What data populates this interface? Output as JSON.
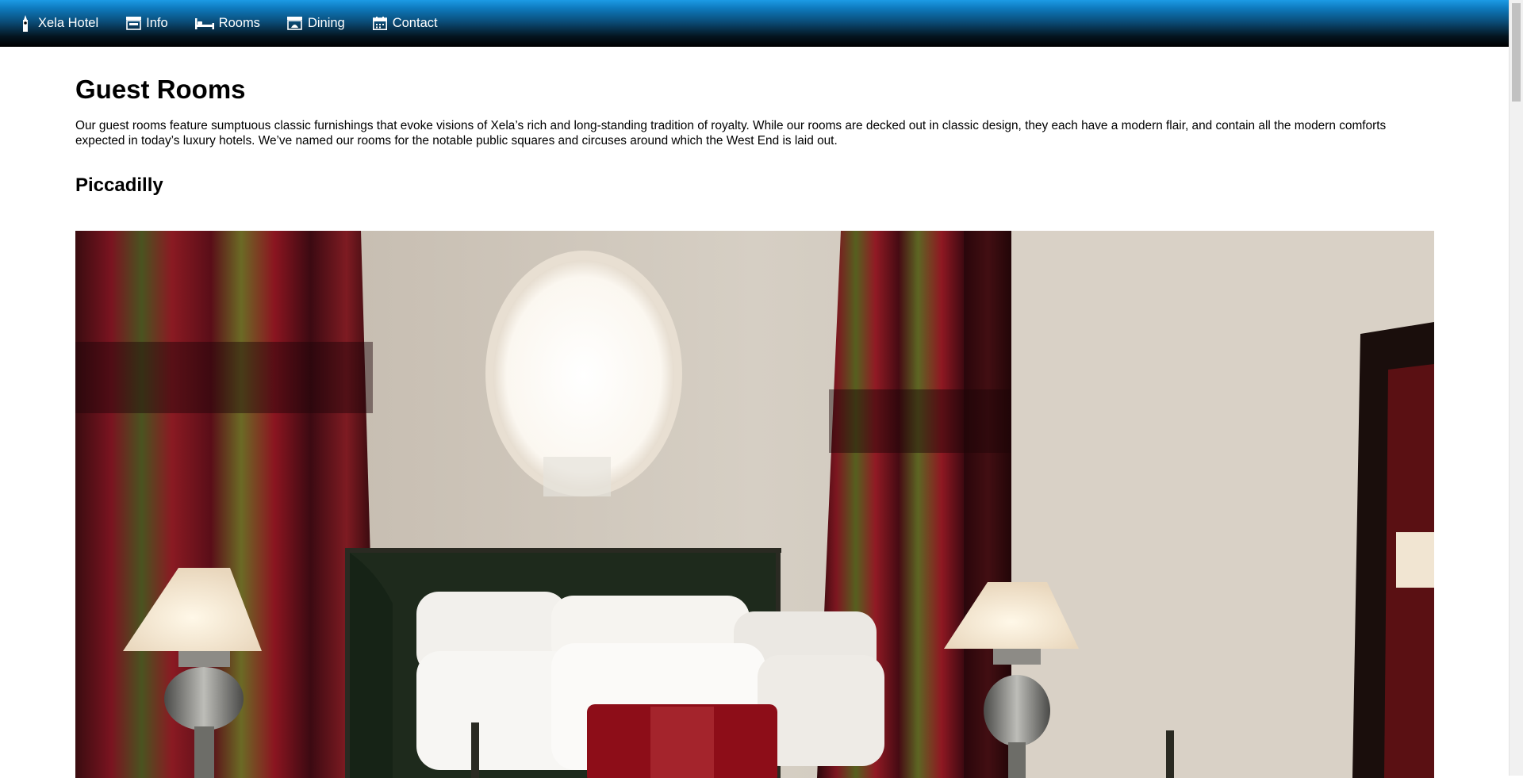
{
  "nav": {
    "items": [
      {
        "label": "Xela Hotel",
        "icon": "bigben-icon"
      },
      {
        "label": "Info",
        "icon": "info-building-icon"
      },
      {
        "label": "Rooms",
        "icon": "bed-icon"
      },
      {
        "label": "Dining",
        "icon": "dining-icon"
      },
      {
        "label": "Contact",
        "icon": "calendar-icon"
      }
    ]
  },
  "page": {
    "title": "Guest Rooms",
    "intro": "Our guest rooms feature sumptuous classic furnishings that evoke visions of Xela’s rich and long-standing tradition of royalty. While our rooms are decked out in classic design, they each have a modern flair, and contain all the modern comforts expected in today’s luxury hotels. We’ve named our rooms for the notable public squares and circuses around which the West End is laid out."
  },
  "rooms": [
    {
      "name": "Piccadilly"
    }
  ],
  "colors": {
    "nav_top": "#1c9be6",
    "nav_bottom": "#000000",
    "curtain_red": "#7a1218",
    "curtain_green": "#5a6a2a",
    "wall": "#cfc7bb"
  }
}
